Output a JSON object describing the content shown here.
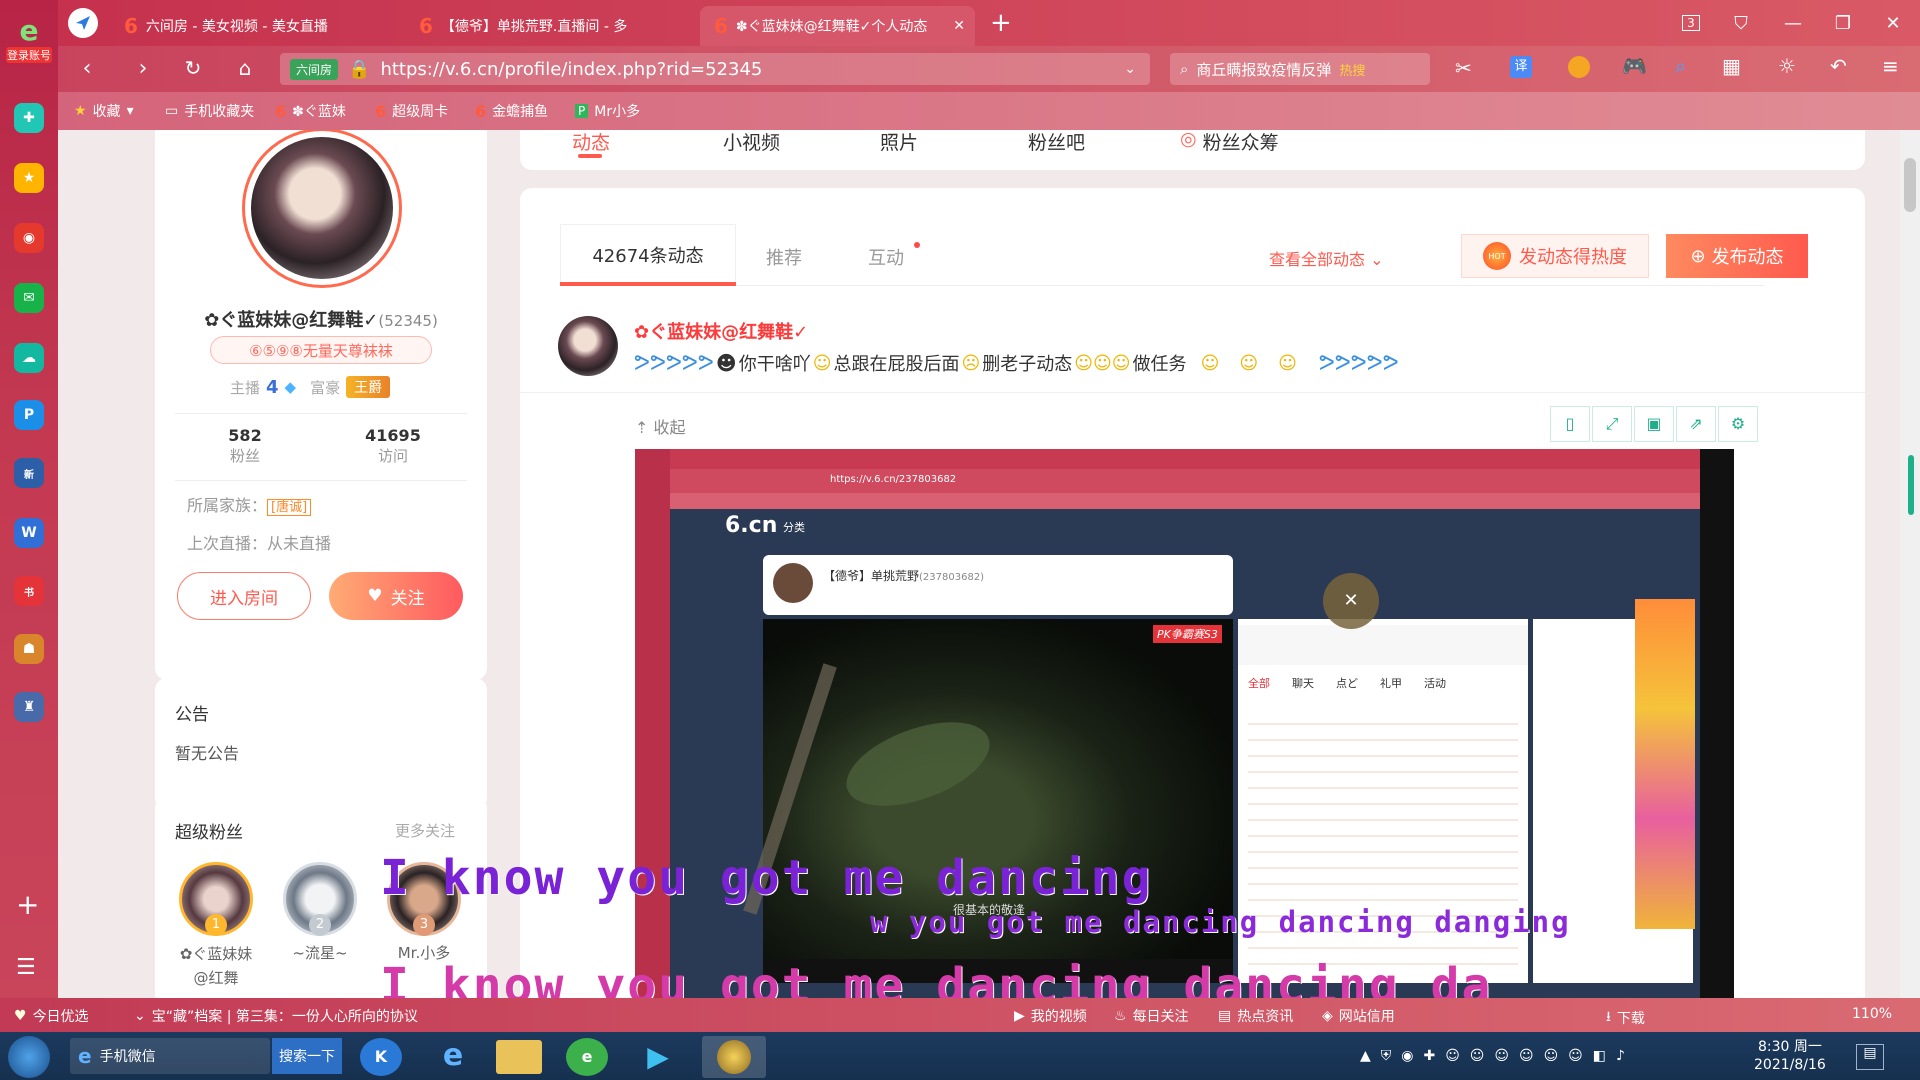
{
  "browser": {
    "left_badge": "登录账号",
    "tabs": [
      {
        "label": "六间房 - 美女视频 - 美女直播"
      },
      {
        "label": "【德爷】单挑荒野.直播间 - 多"
      },
      {
        "label": "✽ぐ蓝妹妹@红舞鞋✓个人动态"
      }
    ],
    "tab_count": "3",
    "url": "https://v.6.cn/profile/index.php?rid=52345",
    "url_chip": "六间房",
    "search_text": "商丘瞒报致疫情反弹",
    "search_hot": "热搜",
    "translate_label": "译",
    "bookmarks": [
      "收藏",
      "手机收藏夹",
      "✽ぐ蓝妹",
      "超级周卡",
      "金蟾捕鱼",
      "Mr小多"
    ]
  },
  "profile": {
    "name": "✿ぐ蓝妹妹@红舞鞋✓",
    "rid": "(52345)",
    "wealth_tag": "⑥⑤⑨⑧无量天尊袜袜",
    "host_label": "主播",
    "host_level": "4",
    "rich_label": "富豪",
    "rich_badge": "王爵",
    "fans_count": "582",
    "fans_label": "粉丝",
    "visits_count": "41695",
    "visits_label": "访问",
    "family_label": "所属家族：",
    "family_badge": "[唐诚]",
    "last_live": "上次直播：从未直播",
    "enter_room": "进入房间",
    "follow": "关注"
  },
  "announcement": {
    "title": "公告",
    "text": "暂无公告"
  },
  "super_fans": {
    "title": "超级粉丝",
    "more": "更多关注",
    "fans": [
      {
        "rank": "1",
        "name": "✿ぐ蓝妹妹@红舞"
      },
      {
        "rank": "2",
        "name": "~流星~"
      },
      {
        "rank": "3",
        "name": "Mr.小多"
      }
    ]
  },
  "nav_tabs": [
    "动态",
    "小视频",
    "照片",
    "粉丝吧",
    "粉丝众筹"
  ],
  "feed": {
    "tabs": [
      "42674条动态",
      "推荐",
      "互动"
    ],
    "view_all": "查看全部动态",
    "heat_button": "发动态得热度",
    "hot_badge": "HOT",
    "publish_button": "发布动态",
    "post_author": "✿ぐ蓝妹妹@红舞鞋✓",
    "post_text_1": "你干啥吖",
    "post_text_2": "总跟在屁股后面",
    "post_text_3": "删老子动态",
    "post_text_4": "做任务",
    "collapse": "收起"
  },
  "inner_shot": {
    "logo": "6.cn",
    "category": "分类",
    "url": "https://v.6.cn/237803682",
    "room_title": "【德爷】单挑荒野",
    "room_id": "(237803682)",
    "fk_label": "PK争霸赛S3",
    "chat_tabs": [
      "全部",
      "聊天",
      "点ど",
      "礼甲",
      "活动"
    ],
    "video_caption": "很基本的敬逢"
  },
  "lyrics": {
    "line1": "I know you got me dancing",
    "line2": "w you got me dancing dancing danging",
    "line3": "I know you got me dancing dancing da"
  },
  "statusbar": {
    "items": [
      "今日优选",
      "宝“藏”档案 | 第三集：一份人心所向的协议",
      "我的视频",
      "每日关注",
      "热点资讯",
      "网站信用",
      "下载"
    ],
    "zoom": "110%"
  },
  "taskbar": {
    "wechat": "手机微信",
    "search_btn": "搜索一下",
    "time": "8:30 周一",
    "date": "2021/8/16"
  },
  "colors": {
    "accent": "#ff5a4e",
    "brand_red": "#c5304d",
    "follow_gradient": "#ff7a59"
  }
}
